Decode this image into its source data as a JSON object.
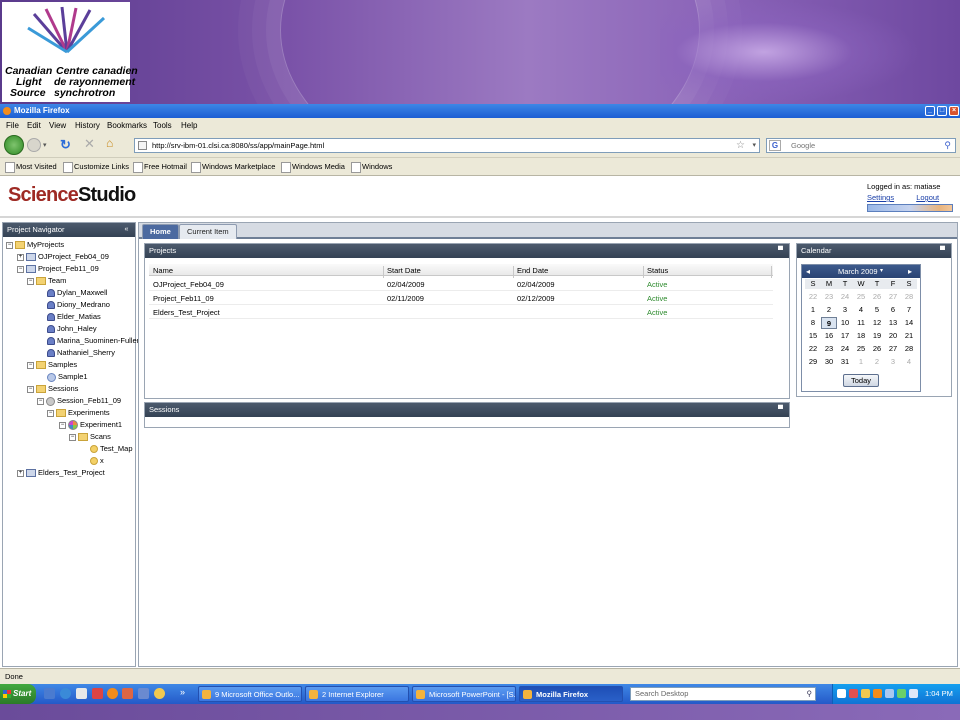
{
  "banner": {
    "logo_lines": [
      "Canadian",
      "Light",
      "Source",
      "Centre canadien",
      "de rayonnement",
      "synchrotron"
    ]
  },
  "browser": {
    "window_title": "Mozilla Firefox",
    "menu": [
      "File",
      "Edit",
      "View",
      "History",
      "Bookmarks",
      "Tools",
      "Help"
    ],
    "url": "http://srv-ibm-01.clsi.ca:8080/ss/app/mainPage.html",
    "search_placeholder": "Google",
    "bookmarks": [
      "Most Visited",
      "Customize Links",
      "Free Hotmail",
      "Windows Marketplace",
      "Windows Media",
      "Windows"
    ],
    "status": "Done"
  },
  "app": {
    "logo_science": "Science",
    "logo_studio": "Studio",
    "logged_in": "Logged in as: matiase",
    "settings": "Settings",
    "logout": "Logout",
    "navigator_title": "Project Navigator",
    "tabs": [
      "Home",
      "Current Item"
    ],
    "tree": [
      "MyProjects",
      "OJProject_Feb04_09",
      "Project_Feb11_09",
      "Team",
      "Dylan_Maxwell",
      "Diony_Medrano",
      "Elder_Matias",
      "John_Haley",
      "Marina_Suominen-Fuller",
      "Nathaniel_Sherry",
      "Samples",
      "Sample1",
      "Sessions",
      "Session_Feb11_09",
      "Experiments",
      "Experiment1",
      "Scans",
      "Test_Map",
      "x",
      "Elders_Test_Project"
    ],
    "projects_panel": {
      "title": "Projects",
      "columns": [
        "Name",
        "Start Date",
        "End Date",
        "Status"
      ],
      "rows": [
        [
          "OJProject_Feb04_09",
          "02/04/2009",
          "02/04/2009",
          "Active"
        ],
        [
          "Project_Feb11_09",
          "02/11/2009",
          "02/12/2009",
          "Active"
        ],
        [
          "Elders_Test_Project",
          "",
          "",
          "Active"
        ]
      ]
    },
    "sessions_panel": {
      "title": "Sessions"
    },
    "calendar_panel": {
      "title": "Calendar",
      "month": "March 2009",
      "dow": [
        "S",
        "M",
        "T",
        "W",
        "T",
        "F",
        "S"
      ],
      "today_label": "Today",
      "weeks": [
        [
          "22",
          "23",
          "24",
          "25",
          "26",
          "27",
          "28"
        ],
        [
          "1",
          "2",
          "3",
          "4",
          "5",
          "6",
          "7"
        ],
        [
          "8",
          "9",
          "10",
          "11",
          "12",
          "13",
          "14"
        ],
        [
          "15",
          "16",
          "17",
          "18",
          "19",
          "20",
          "21"
        ],
        [
          "22",
          "23",
          "24",
          "25",
          "26",
          "27",
          "28"
        ],
        [
          "29",
          "30",
          "31",
          "1",
          "2",
          "3",
          "4"
        ]
      ]
    }
  },
  "taskbar": {
    "start": "Start",
    "buttons": [
      "9 Microsoft Office Outlo...",
      "2 Internet Explorer",
      "Microsoft PowerPoint - [S...",
      "Mozilla Firefox"
    ],
    "search": "Search Desktop",
    "clock": "1:04 PM"
  }
}
